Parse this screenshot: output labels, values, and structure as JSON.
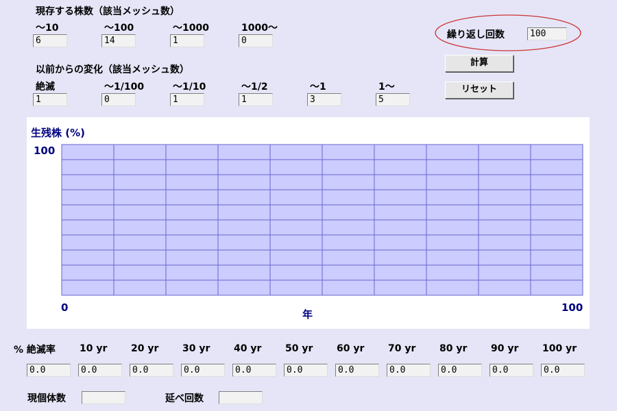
{
  "current": {
    "title": "現存する株数（該当メッシュ数）",
    "items": [
      {
        "label": "～10",
        "value": "6"
      },
      {
        "label": "～100",
        "value": "14"
      },
      {
        "label": "～1000",
        "value": "1"
      },
      {
        "label": "1000～",
        "value": "0"
      }
    ]
  },
  "change": {
    "title": "以前からの変化（該当メッシュ数）",
    "items": [
      {
        "label": "絶滅",
        "value": "1"
      },
      {
        "label": "～1/100",
        "value": "0"
      },
      {
        "label": "～1/10",
        "value": "1"
      },
      {
        "label": "～1/2",
        "value": "1"
      },
      {
        "label": "～1",
        "value": "3"
      },
      {
        "label": "1～",
        "value": "5"
      }
    ]
  },
  "repeat": {
    "label": "繰り返し回数",
    "value": "100"
  },
  "buttons": {
    "calc": "計算",
    "reset": "リセット"
  },
  "chart_data": {
    "type": "line",
    "title": "生残株 (%)",
    "xlabel": "年",
    "ylabel": "生残株 (%)",
    "xlim": [
      0,
      100
    ],
    "ylim": [
      0,
      100
    ],
    "x_tick_labels": [
      "0",
      "100"
    ],
    "y_tick_labels": [
      "100"
    ],
    "grid": true,
    "plot_background": "#ccccff",
    "grid_color": "#6666cc",
    "series": []
  },
  "extinction": {
    "label": "% 絶滅率",
    "years": [
      {
        "label": "10 yr",
        "value": "0.0"
      },
      {
        "label": "20 yr",
        "value": "0.0"
      },
      {
        "label": "30 yr",
        "value": "0.0"
      },
      {
        "label": "40 yr",
        "value": "0.0"
      },
      {
        "label": "50 yr",
        "value": "0.0"
      },
      {
        "label": "60 yr",
        "value": "0.0"
      },
      {
        "label": "70 yr",
        "value": "0.0"
      },
      {
        "label": "80 yr",
        "value": "0.0"
      },
      {
        "label": "90 yr",
        "value": "0.0"
      },
      {
        "label": "100 yr",
        "value": "0.0"
      }
    ]
  },
  "footer": {
    "population_label": "現個体数",
    "population_value": "",
    "total_runs_label": "延べ回数",
    "total_runs_value": ""
  }
}
